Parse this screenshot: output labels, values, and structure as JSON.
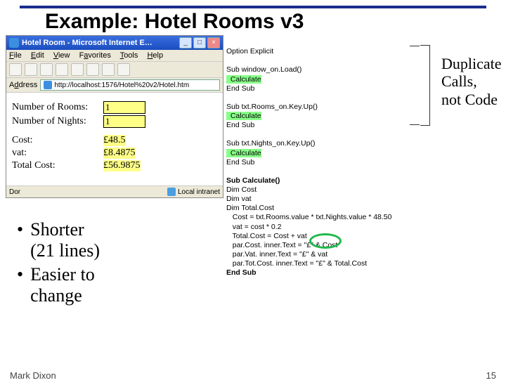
{
  "slide": {
    "title": "Example: Hotel Rooms v3",
    "footer_author": "Mark Dixon",
    "footer_page": "15"
  },
  "bullets": {
    "b1_l1": "Shorter",
    "b1_l2": "(21 lines)",
    "b2_l1": "Easier to",
    "b2_l2": "change"
  },
  "callout": {
    "l1": "Duplicate",
    "l2": "Calls,",
    "l3": "not Code"
  },
  "browser": {
    "title": "Hotel Room - Microsoft Internet E…",
    "menu": {
      "file": "File",
      "edit": "Edit",
      "view": "View",
      "favorites": "Favorites",
      "tools": "Tools",
      "help": "Help"
    },
    "address_label": "Address",
    "url": "http://localhost:1576/Hotel%20v2/Hotel.htm",
    "status_left": "Dor",
    "status_right": "Local intranet",
    "page": {
      "rooms_label": "Number of Rooms:",
      "rooms_value": "1",
      "nights_label": "Number of Nights:",
      "nights_value": "1",
      "cost_label": "Cost:",
      "cost_value": "£48.5",
      "vat_label": "vat:",
      "vat_value": "£8.4875",
      "total_label": "Total Cost:",
      "total_value": "£56.9875"
    }
  },
  "code": {
    "l01": "Option Explicit",
    "l02": "",
    "l03": "Sub window_on.Load()",
    "l04": "  Calculate",
    "l05": "End Sub",
    "l06": "",
    "l07": "Sub txt.Rooms_on.Key.Up()",
    "l08": "  Calculate",
    "l09": "End Sub",
    "l10": "",
    "l11": "Sub txt.Nights_on.Key.Up()",
    "l12": "  Calculate",
    "l13": "End Sub",
    "l14": "",
    "l15": "Sub Calculate()",
    "l16": "Dim Cost",
    "l17": "Dim vat",
    "l18": "Dim Total.Cost",
    "l19": "   Cost = txt.Rooms.value * txt.Nights.value * 48.50",
    "l20": "   vat = cost * 0.2",
    "l21": "   Total.Cost = Cost + vat",
    "l22a": "   par.Cost. inner.Text",
    "l22b": " = \"£\" ",
    "l22c": "& Cost",
    "l23a": "   par.Vat. inner.Text = ",
    "l23b": "\"£\"",
    "l23c": " & vat",
    "l24": "   par.Tot.Cost. inner.Text = \"£\" & Total.Cost",
    "l25": "End Sub"
  }
}
